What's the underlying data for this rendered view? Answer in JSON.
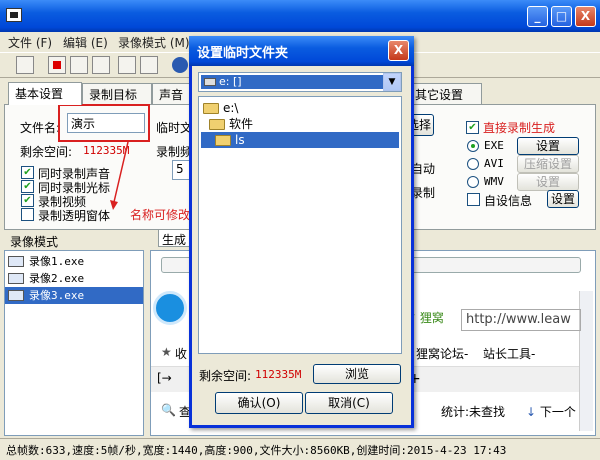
{
  "main": {
    "window_buttons": [
      "_",
      "□",
      "X"
    ],
    "menu": [
      "文件 (F)",
      "编辑 (E)",
      "录像模式 (M)"
    ],
    "tabs": [
      "基本设置",
      "录制目标",
      "声音",
      "其它设置"
    ],
    "filename_label": "文件名:",
    "filename_value": "演示",
    "space_label": "剩余空间:",
    "space_value": "112335M",
    "checkboxes": [
      {
        "label": "同时录制声音",
        "checked": true
      },
      {
        "label": "同时录制光标",
        "checked": true
      },
      {
        "label": "录制视频",
        "checked": true
      },
      {
        "label": "录制透明窗体",
        "checked": false
      }
    ],
    "annotation": "名称可修改",
    "temp_label": "临时文",
    "record_label": "录制频",
    "fps_value": "5",
    "select_btn": "选择",
    "auto_label": "自动",
    "record2_label": "录制",
    "direct_record_label": "直接录制生成",
    "formats": [
      {
        "label": "EXE",
        "selected": true,
        "button": "设置",
        "button_enabled": true
      },
      {
        "label": "AVI",
        "selected": false,
        "button": "压缩设置",
        "button_enabled": false
      },
      {
        "label": "WMV",
        "selected": false,
        "button": "设置",
        "button_enabled": false
      }
    ],
    "custom_info_label": "自设信息",
    "custom_info_btn": "设置",
    "mode_header": "录像模式",
    "generate_header": "生成",
    "files": [
      {
        "name": "录像1.exe",
        "selected": false
      },
      {
        "name": "录像2.exe",
        "selected": false
      },
      {
        "name": "录像3.exe",
        "selected": true
      }
    ],
    "browser": {
      "secure_label": "狸窝",
      "url": "http://www.leaw",
      "favorites": [
        "收",
        "狸窝论坛-",
        "站长工具-"
      ],
      "stat": "统计:未查找",
      "next": "下一个",
      "search_prefix": "查"
    },
    "status_bar": "总帧数:633,速度:5帧/秒,宽度:1440,高度:900,文件大小:8560KB,创建时间:2015-4-23  17:43"
  },
  "dialog": {
    "title": "设置临时文件夹",
    "close": "X",
    "drive": "e: []",
    "tree": [
      {
        "name": "e:\\",
        "selected": false
      },
      {
        "name": "软件",
        "selected": false
      },
      {
        "name": "ls",
        "selected": true
      }
    ],
    "space_label": "剩余空间:",
    "space_value": "112335M",
    "browse_btn": "浏览",
    "ok_btn": "确认(O)",
    "cancel_btn": "取消(C)"
  }
}
